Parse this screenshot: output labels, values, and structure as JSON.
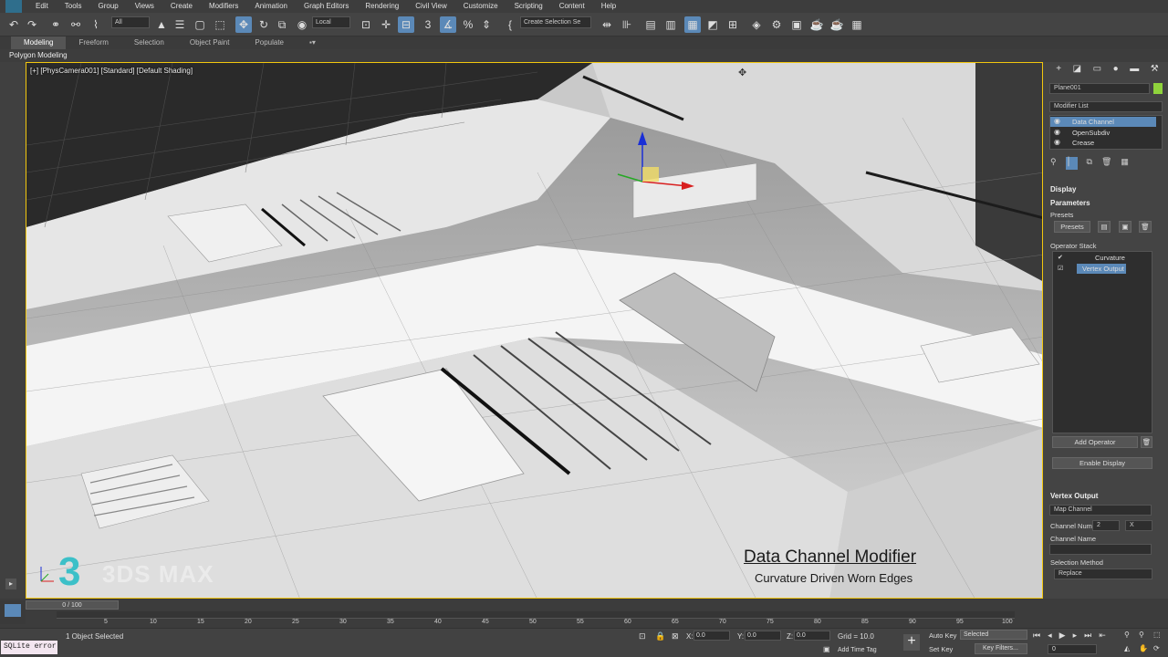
{
  "menu": [
    "Edit",
    "Tools",
    "Group",
    "Views",
    "Create",
    "Modifiers",
    "Animation",
    "Graph Editors",
    "Rendering",
    "Civil View",
    "Customize",
    "Scripting",
    "Content",
    "Help"
  ],
  "toolbar": {
    "filter": "All",
    "coord": "Local",
    "selection_set": "Create Selection Se"
  },
  "ribbon_tabs": [
    "Modeling",
    "Freeform",
    "Selection",
    "Object Paint",
    "Populate"
  ],
  "ribbon_active": "Modeling",
  "polygon_modeling": "Polygon Modeling",
  "viewport": {
    "label": "[+] [PhysCamera001] [Standard] [Default Shading]",
    "brand": "3DS MAX",
    "brand_digit": "3",
    "title": "Data Channel Modifier",
    "subtitle": "Curvature Driven Worn Edges"
  },
  "panel": {
    "object_name": "Plane001",
    "modifier_list": "Modifier List",
    "stack": [
      "Data Channel",
      "OpenSubdiv",
      "Crease"
    ],
    "display_head": "Display",
    "params_head": "Parameters",
    "presets_label": "Presets",
    "presets_btn": "Presets",
    "operator_stack_label": "Operator Stack",
    "operators": [
      "Curvature",
      "Vertex Output"
    ],
    "add_operator": "Add Operator",
    "enable_display": "Enable Display",
    "vertex_output_head": "Vertex Output",
    "map_channel": "Map Channel",
    "channel_num_label": "Channel Num",
    "channel_num": "2",
    "channel_x": "X",
    "channel_name_label": "Channel Name",
    "selection_method_label": "Selection Method",
    "selection_method": "Replace"
  },
  "timeline": {
    "frame": "0 / 100",
    "ticks": [
      "5",
      "10",
      "15",
      "20",
      "25",
      "30",
      "35",
      "40",
      "45",
      "50",
      "55",
      "60",
      "65",
      "70",
      "75",
      "80",
      "85",
      "90",
      "95",
      "100"
    ]
  },
  "status": {
    "error": "SQLite error",
    "selected": "1 Object Selected",
    "x_label": "X:",
    "x": "0.0",
    "y_label": "Y:",
    "y": "0.0",
    "z_label": "Z:",
    "z": "0.0",
    "grid": "Grid = 10.0",
    "add_time_tag": "Add Time Tag",
    "auto_key": "Auto Key",
    "set_key": "Set Key",
    "key_sel": "Selected",
    "key_filters": "Key Filters...",
    "frame_field": "0"
  }
}
